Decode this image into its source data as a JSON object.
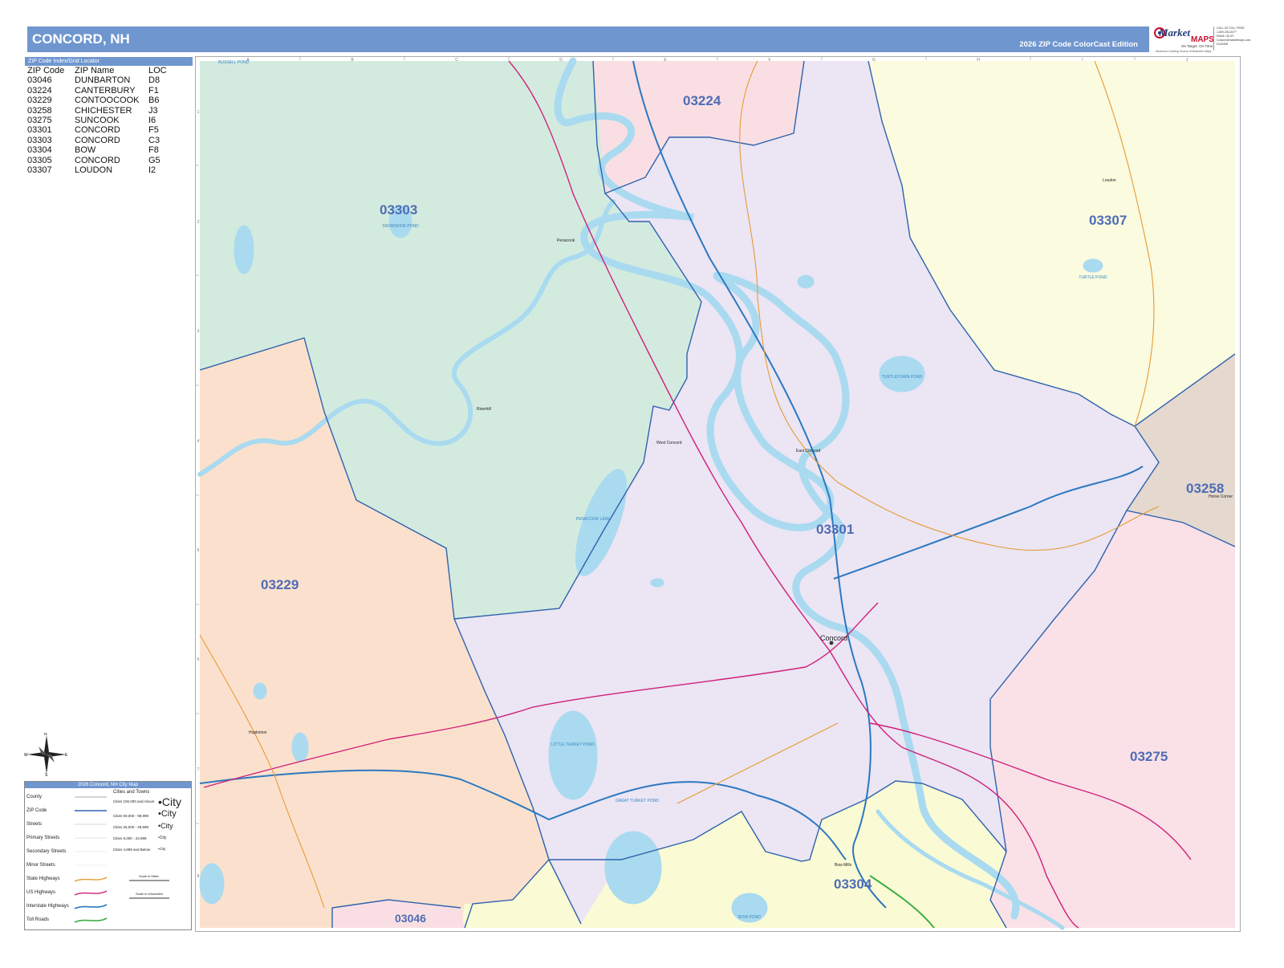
{
  "header": {
    "title": "CONCORD, NH",
    "edition": "2026 ZIP Code ColorCast Edition"
  },
  "logo": {
    "brand_top": "Market",
    "brand_bottom": "MAPS",
    "tagline": "On Target. On Time.",
    "subtagline": "America's Leading Source of Business Maps",
    "contact_lines": [
      "CALL US TOLL FREE:",
      "1-800-334-6277",
      "EMAIL US AT:",
      "Custom@marketmaps.com",
      "D123456"
    ]
  },
  "zip_index": {
    "title": "ZIP Code Index/Grid Locator",
    "headers": [
      "ZIP Code",
      "ZIP Name",
      "LOC"
    ],
    "rows": [
      [
        "03046",
        "DUNBARTON",
        "D8"
      ],
      [
        "03224",
        "CANTERBURY",
        "F1"
      ],
      [
        "03229",
        "CONTOOCOOK",
        "B6"
      ],
      [
        "03258",
        "CHICHESTER",
        "J3"
      ],
      [
        "03275",
        "SUNCOOK",
        "I6"
      ],
      [
        "03301",
        "CONCORD",
        "F5"
      ],
      [
        "03303",
        "CONCORD",
        "C3"
      ],
      [
        "03304",
        "BOW",
        "F8"
      ],
      [
        "03305",
        "CONCORD",
        "G5"
      ],
      [
        "03307",
        "LOUDON",
        "I2"
      ]
    ]
  },
  "map": {
    "grid_columns": [
      "A",
      "B",
      "C",
      "D",
      "E",
      "F",
      "G",
      "H",
      "I",
      "J"
    ],
    "grid_rows": [
      "1",
      "2",
      "3",
      "4",
      "5",
      "6",
      "7",
      "8"
    ],
    "zip_labels": [
      "03224",
      "03303",
      "03307",
      "03258",
      "03301",
      "03229",
      "03275",
      "03304",
      "03046"
    ],
    "city_labels": [
      "Concord",
      "Penacook",
      "Riverhill",
      "West Concord",
      "East Concord",
      "Loudon",
      "Horse Corner",
      "Hopkinton",
      "Bow Mills"
    ],
    "water_labels": [
      "LITTLE TURKEY POND",
      "GREAT TURKEY POND",
      "PENACOOK LAKE",
      "TURTLETOWN POND",
      "SNOWSHOE POND",
      "TURTLE POND",
      "BOW POND",
      "RUSSELL POND"
    ],
    "zip_colors": {
      "03303": "#d3ebdf",
      "03224": "#f9dfe4",
      "03307": "#fafbdf",
      "03258": "#e4d8cf",
      "03301": "#ebe5f4",
      "03229": "#fbe1cd",
      "03275": "#f9e1e7",
      "03304": "#fafbd4",
      "03046": "#f9dfe4"
    },
    "colors": {
      "zip_boundary": "#2f62ad",
      "water": "#a9daf0",
      "us_highway": "#d0207a",
      "interstate": "#2c78c0",
      "state_highway": "#e79a35",
      "toll": "#3fae49",
      "zip_label": "#4f6cb4"
    }
  },
  "compass": {
    "n": "N",
    "s": "S",
    "e": "E",
    "w": "W"
  },
  "legend": {
    "title": "2026 Concord, NH City Map",
    "items": [
      "County",
      "ZIP Code",
      "Streets",
      "Primary Streets",
      "Secondary Streets",
      "Minor Streets",
      "State Highways",
      "US Highways",
      "Interstate Highways",
      "Toll Roads"
    ],
    "cities_header": "Cities and Towns",
    "city_sizes": [
      {
        "range": "Cities 100,000 and Above",
        "sample": "•City"
      },
      {
        "range": "Cities 50,000 - 99,999",
        "sample": "•City"
      },
      {
        "range": "Cities 25,000 - 49,999",
        "sample": "•City"
      },
      {
        "range": "Cities 5,000 - 24,999",
        "sample": "•City"
      },
      {
        "range": "Cities 4,999 and Below",
        "sample": "•City"
      }
    ],
    "scale_miles": "Scale in Miles",
    "scale_km": "Scale in Kilometers"
  }
}
